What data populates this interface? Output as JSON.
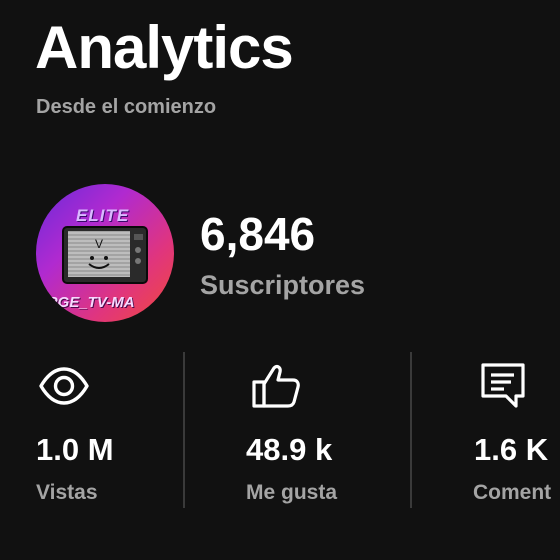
{
  "header": {
    "title": "Analytics",
    "subtitle": "Desde el comienzo"
  },
  "channel": {
    "avatar_text_top": "ELITE",
    "avatar_text_bottom": "ARGE_TV-MA",
    "subscriber_count": "6,846",
    "subscriber_label": "Suscriptores"
  },
  "stats": [
    {
      "icon": "eye-icon",
      "value": "1.0 M",
      "label": "Vistas"
    },
    {
      "icon": "thumbs-up-icon",
      "value": "48.9 k",
      "label": "Me gusta"
    },
    {
      "icon": "comment-icon",
      "value": "1.6 K",
      "label": "Coment"
    }
  ],
  "colors": {
    "background": "#111111",
    "text_primary": "#ffffff",
    "text_secondary": "#a4a4a4",
    "divider": "#3a3a3a"
  }
}
